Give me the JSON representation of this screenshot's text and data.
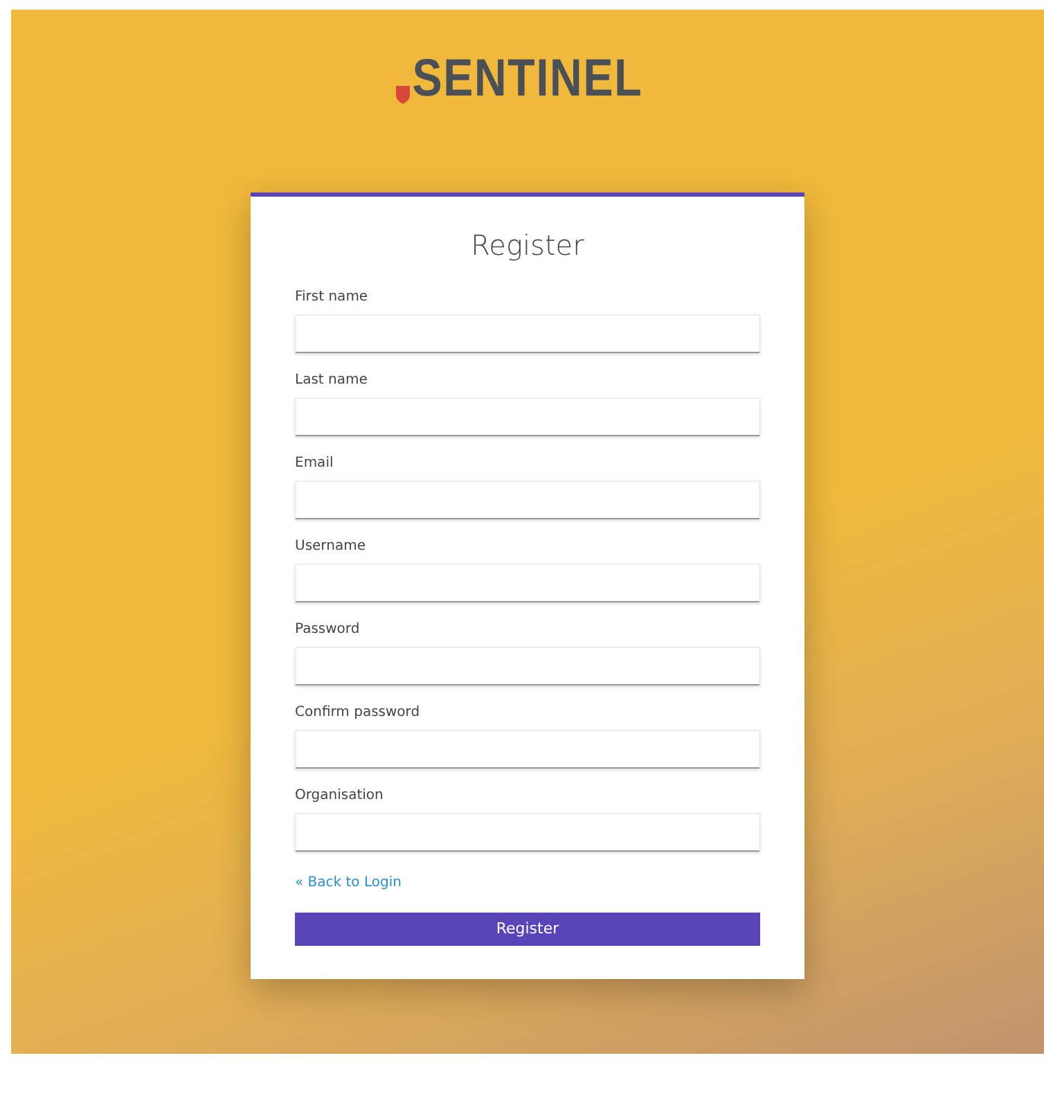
{
  "logo": {
    "text": "SENTINEL"
  },
  "form": {
    "title": "Register",
    "fields": [
      {
        "label": "First name"
      },
      {
        "label": "Last name"
      },
      {
        "label": "Email"
      },
      {
        "label": "Username"
      },
      {
        "label": "Password"
      },
      {
        "label": "Confirm password"
      },
      {
        "label": "Organisation"
      }
    ],
    "back_link": "« Back to Login",
    "submit": "Register"
  }
}
